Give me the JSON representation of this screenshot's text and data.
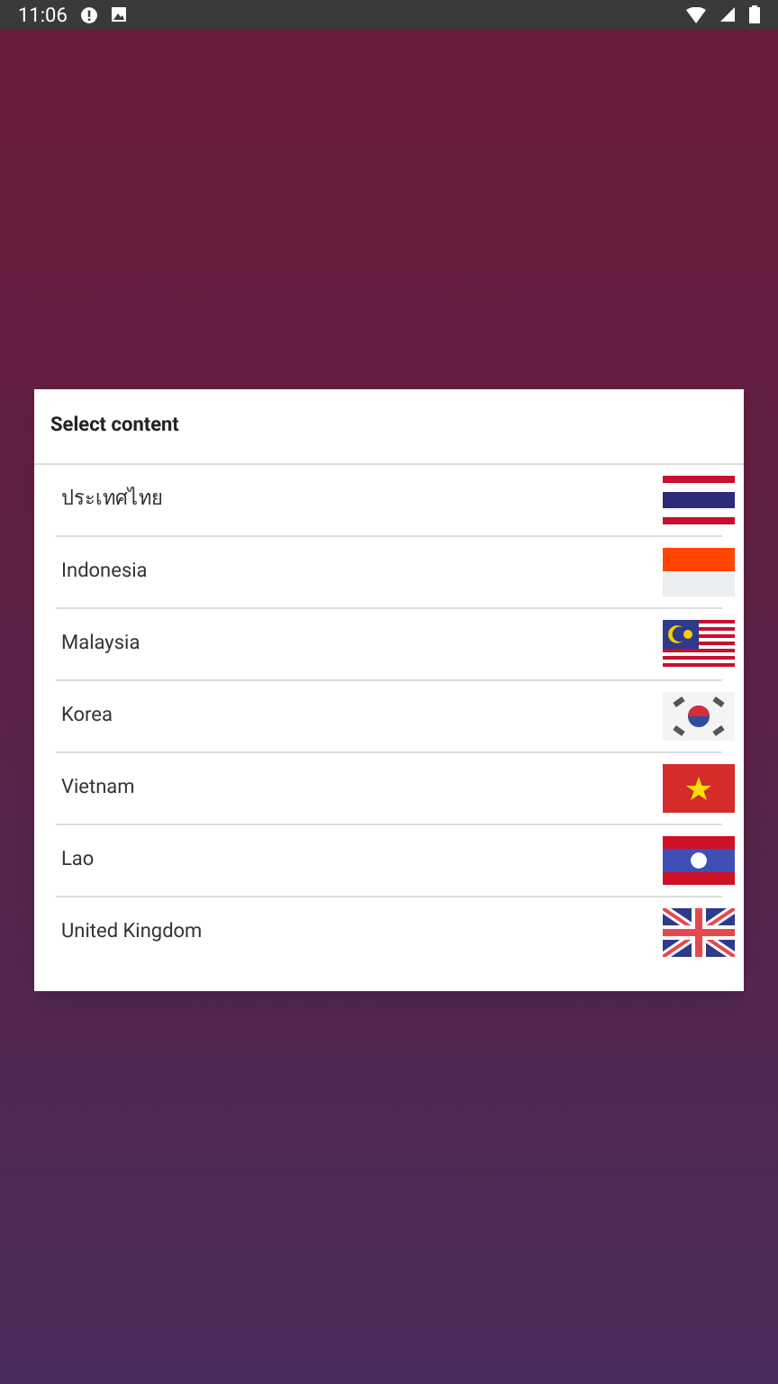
{
  "status_bar": {
    "time": "11:06"
  },
  "dialog": {
    "title": "Select content",
    "items": [
      {
        "label": "ประเทศไทย",
        "kind": "thailand"
      },
      {
        "label": "Indonesia",
        "kind": "indonesia"
      },
      {
        "label": "Malaysia",
        "kind": "malaysia"
      },
      {
        "label": "Korea",
        "kind": "korea"
      },
      {
        "label": "Vietnam",
        "kind": "vietnam"
      },
      {
        "label": "Lao",
        "kind": "lao"
      },
      {
        "label": "United Kingdom",
        "kind": "uk"
      }
    ]
  }
}
